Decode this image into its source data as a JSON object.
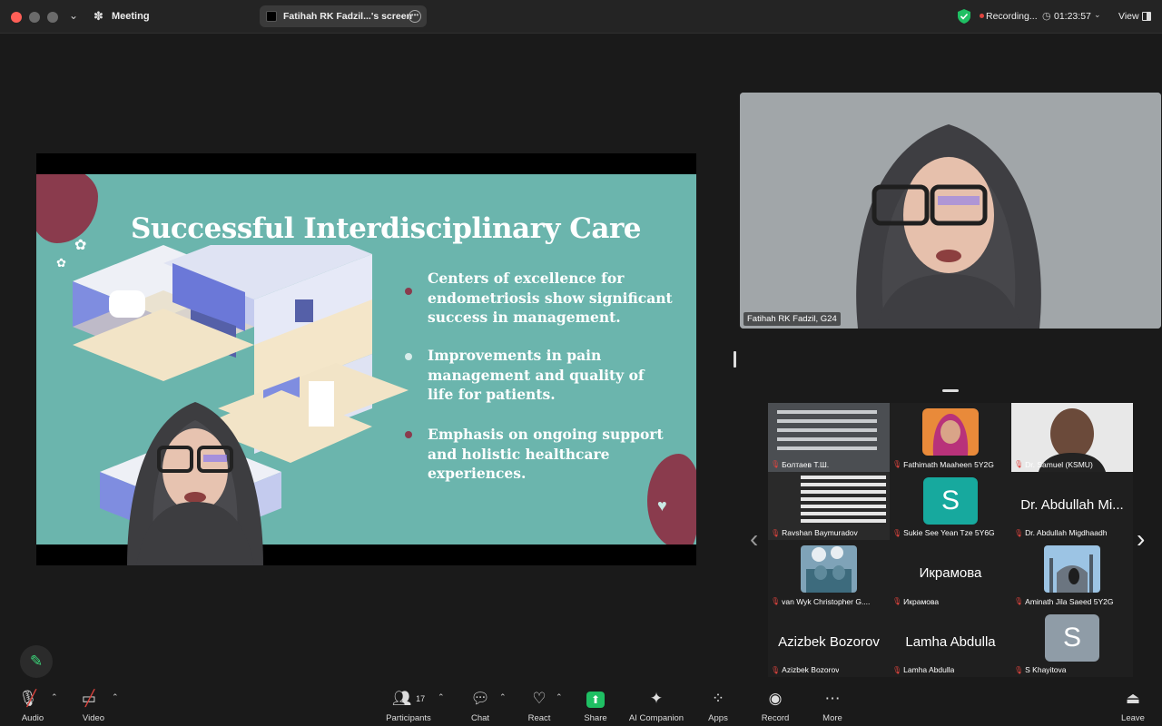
{
  "titlebar": {
    "meeting_label": "Meeting",
    "screen_label": "Fatihah RK Fadzil...'s screen",
    "recording_label": "Recording...",
    "timer": "01:23:57",
    "view_label": "View"
  },
  "slide": {
    "title": "Successful Interdisciplinary Care",
    "bullets": [
      {
        "text": "Centers of excellence for endometriosis show significant success in management.",
        "dot_color": "#8a3b4d"
      },
      {
        "text": "Improvements in pain management and quality of life for patients.",
        "dot_color": "#d8ecea"
      },
      {
        "text": "Emphasis on ongoing support and holistic healthcare experiences.",
        "dot_color": "#8a3b4d"
      }
    ]
  },
  "main_video": {
    "name": "Fatihah RK Fadzil, G24"
  },
  "gallery": [
    {
      "name": "Болтаев Т.Ш.",
      "kind": "video"
    },
    {
      "name": "Fathimath Maaheen 5Y2G",
      "kind": "photo"
    },
    {
      "name": "Dr. Samuel (KSMU)",
      "kind": "video"
    },
    {
      "name": "Ravshan Baymuradov",
      "kind": "video"
    },
    {
      "name": "Sukie See Yean Tze 5Y6G",
      "kind": "avatar",
      "initial": "S"
    },
    {
      "name": "Dr. Abdullah Migdhaadh",
      "kind": "text",
      "display": "Dr. Abdullah Mi..."
    },
    {
      "name": "van Wyk Christopher G....",
      "kind": "photo"
    },
    {
      "name": "Икрамова",
      "kind": "text",
      "display": "Икрамова"
    },
    {
      "name": "Aminath Jila Saeed 5Y2G",
      "kind": "photo"
    },
    {
      "name": "Azizbek Bozorov",
      "kind": "text",
      "display": "Azizbek Bozorov"
    },
    {
      "name": "Lamha Abdulla",
      "kind": "text",
      "display": "Lamha Abdulla"
    },
    {
      "name": "S Khayitova",
      "kind": "avatar",
      "initial": "S"
    }
  ],
  "toolbar": {
    "audio": "Audio",
    "video": "Video",
    "participants": "Participants",
    "participants_count": "17",
    "chat": "Chat",
    "react": "React",
    "share": "Share",
    "ai_companion": "AI Companion",
    "apps": "Apps",
    "record": "Record",
    "more": "More",
    "leave": "Leave"
  },
  "colors": {
    "slide_bg": "#6bb5ad",
    "slide_accent": "#8a3b4d",
    "share_green": "#1fbf63",
    "muted_red": "#e0443e"
  }
}
